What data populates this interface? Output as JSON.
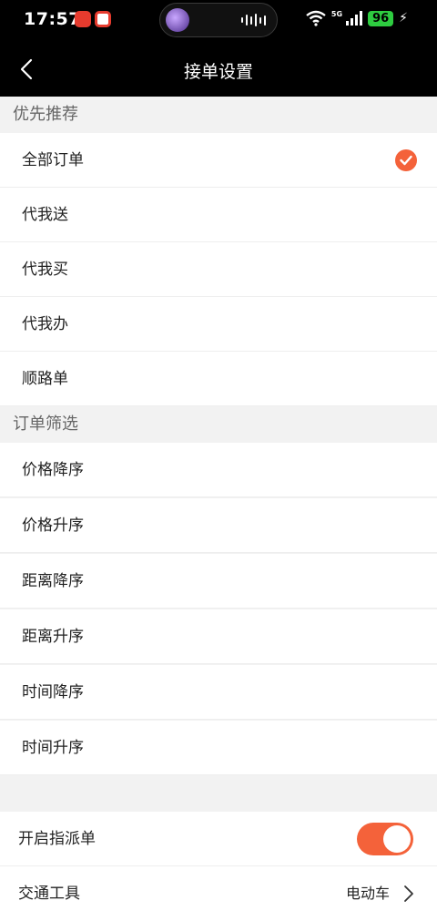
{
  "status_bar": {
    "time": "17:57",
    "network": "5G",
    "battery": "96"
  },
  "nav": {
    "title": "接单设置"
  },
  "priority_section": {
    "title": "优先推荐",
    "items": [
      {
        "label": "全部订单",
        "selected": true
      },
      {
        "label": "代我送",
        "selected": false
      },
      {
        "label": "代我买",
        "selected": false
      },
      {
        "label": "代我办",
        "selected": false
      },
      {
        "label": "顺路单",
        "selected": false
      }
    ]
  },
  "filter_section": {
    "title": "订单筛选",
    "items": [
      {
        "label": "价格降序"
      },
      {
        "label": "价格升序"
      },
      {
        "label": "距离降序"
      },
      {
        "label": "距离升序"
      },
      {
        "label": "时间降序"
      },
      {
        "label": "时间升序"
      }
    ]
  },
  "settings": {
    "dispatch": {
      "label": "开启指派单",
      "enabled": true
    },
    "vehicle": {
      "label": "交通工具",
      "value": "电动车"
    }
  },
  "colors": {
    "accent": "#f4623a",
    "background": "#f2f2f2",
    "nav_background": "#000000"
  }
}
